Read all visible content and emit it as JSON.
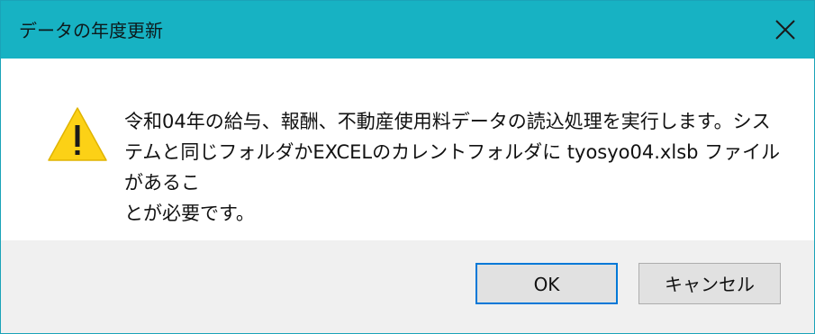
{
  "window": {
    "title": "データの年度更新",
    "close_icon": "close-icon"
  },
  "message": {
    "icon": "warning-icon",
    "text": "令和04年の給与、報酬、不動産使用料データの読込処理を実行します。シス\nテムと同じフォルダかEXCELのカレントフォルダに tyosyo04.xlsb ファイルがあるこ\nとが必要です。"
  },
  "buttons": {
    "ok_label": "OK",
    "cancel_label": "キャンセル"
  },
  "colors": {
    "titlebar": "#17b2c3",
    "footer": "#f0f0f0",
    "focus_border": "#0078d7",
    "warning_yellow": "#fcd116"
  }
}
